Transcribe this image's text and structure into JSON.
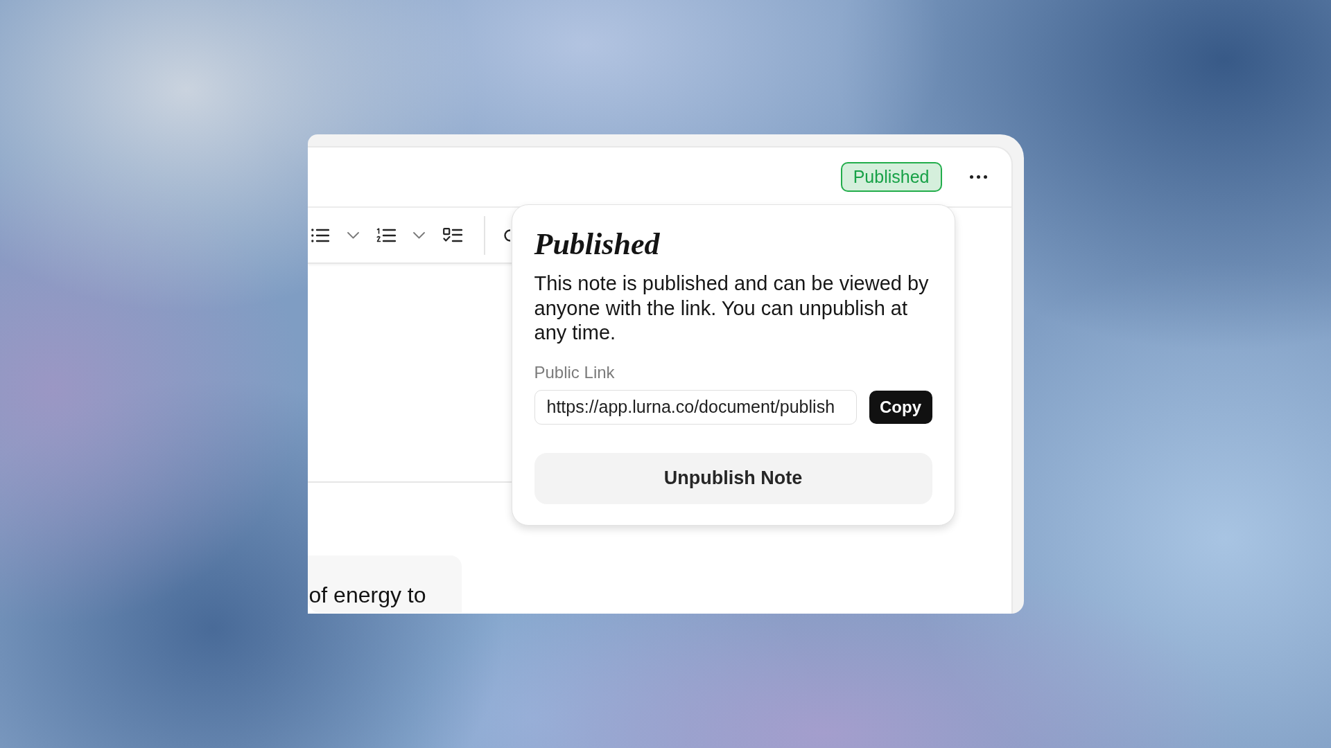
{
  "header": {
    "status_badge": "Published"
  },
  "editor": {
    "visible_text": "of energy to"
  },
  "popover": {
    "title": "Published",
    "description": "This note is published and can be viewed by anyone with the link. You can unpublish at any time.",
    "link_label": "Public Link",
    "link_field": {
      "value": "https://app.lurna.co/document/publish"
    },
    "copy_button": "Copy",
    "unpublish_button": "Unpublish Note"
  }
}
